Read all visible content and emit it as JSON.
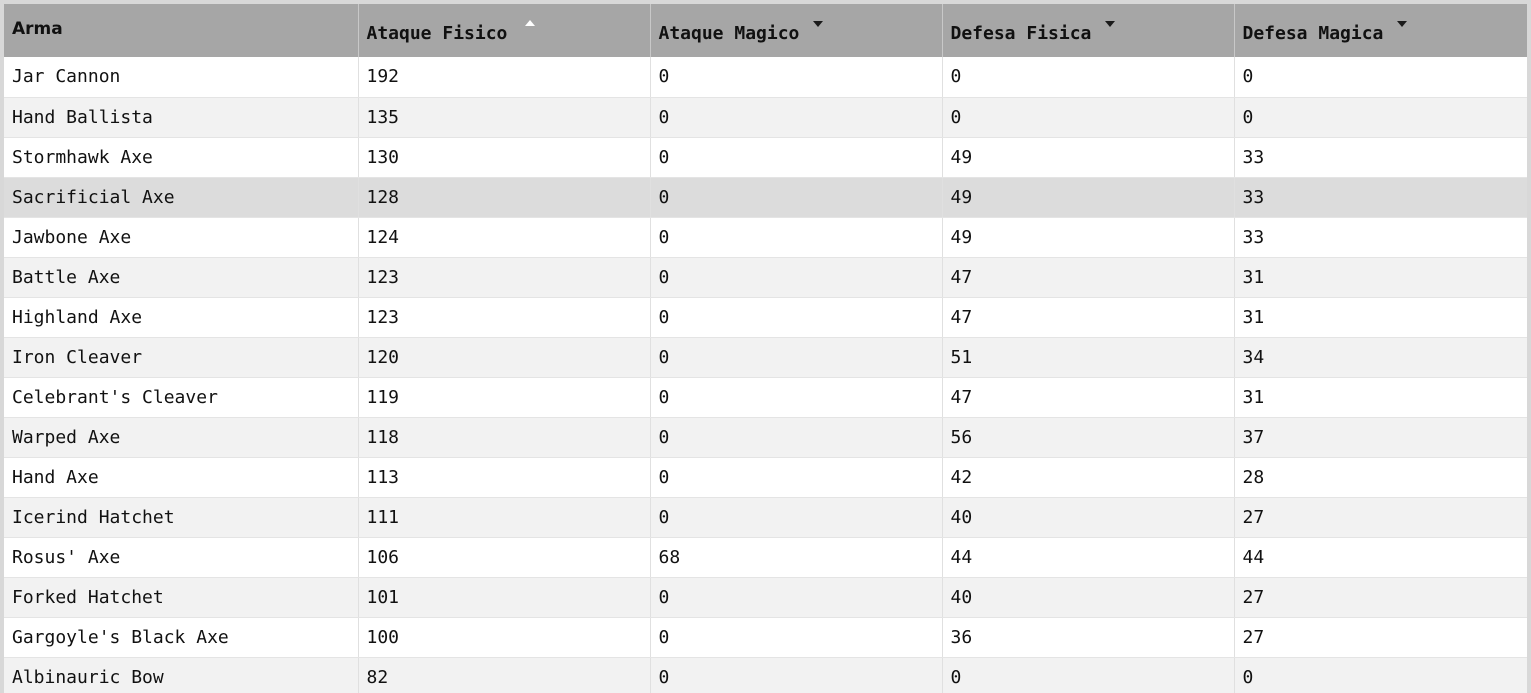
{
  "table": {
    "headers": [
      {
        "label": "Arma",
        "sort": ""
      },
      {
        "label": "Ataque Fisico",
        "sort": "up"
      },
      {
        "label": "Ataque Magico",
        "sort": "down"
      },
      {
        "label": "Defesa Fisica",
        "sort": "down"
      },
      {
        "label": "Defesa Magica",
        "sort": "down"
      }
    ],
    "rows": [
      [
        "Jar Cannon",
        "192",
        "0",
        "0",
        "0"
      ],
      [
        "Hand Ballista",
        "135",
        "0",
        "0",
        "0"
      ],
      [
        "Stormhawk Axe",
        "130",
        "0",
        "49",
        "33"
      ],
      [
        "Sacrificial Axe",
        "128",
        "0",
        "49",
        "33"
      ],
      [
        "Jawbone Axe",
        "124",
        "0",
        "49",
        "33"
      ],
      [
        "Battle Axe",
        "123",
        "0",
        "47",
        "31"
      ],
      [
        "Highland Axe",
        "123",
        "0",
        "47",
        "31"
      ],
      [
        "Iron Cleaver",
        "120",
        "0",
        "51",
        "34"
      ],
      [
        "Celebrant's Cleaver",
        "119",
        "0",
        "47",
        "31"
      ],
      [
        "Warped Axe",
        "118",
        "0",
        "56",
        "37"
      ],
      [
        "Hand Axe",
        "113",
        "0",
        "42",
        "28"
      ],
      [
        "Icerind Hatchet",
        "111",
        "0",
        "40",
        "27"
      ],
      [
        "Rosus' Axe",
        "106",
        "68",
        "44",
        "44"
      ],
      [
        "Forked Hatchet",
        "101",
        "0",
        "40",
        "27"
      ],
      [
        "Gargoyle's Black Axe",
        "100",
        "0",
        "36",
        "27"
      ],
      [
        "Albinauric Bow",
        "82",
        "0",
        "0",
        "0"
      ]
    ],
    "highlighted_row": 3
  },
  "colors": {
    "header_bg": "#a6a6a6",
    "row_alt_bg": "#f2f2f2",
    "row_hover_bg": "#dcdcdc"
  }
}
